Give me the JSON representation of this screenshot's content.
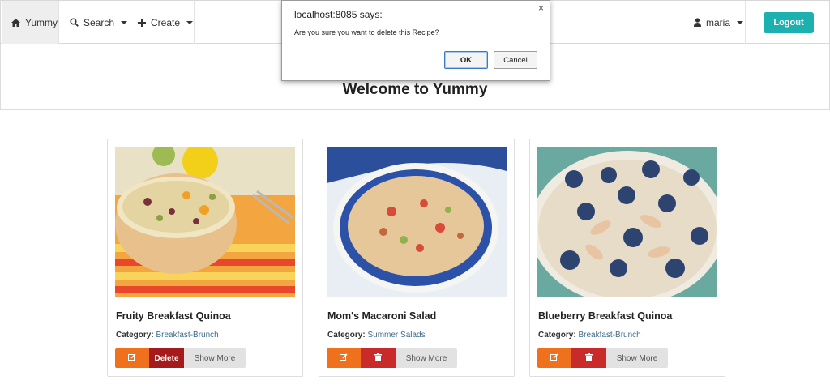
{
  "navbar": {
    "home_label": "Yummy",
    "search_label": "Search",
    "create_label": "Create",
    "user_label": "maria",
    "logout_label": "Logout"
  },
  "header": {
    "title": "Welcome to Yummy"
  },
  "recipes": [
    {
      "name": "Fruity Breakfast Quinoa",
      "category_label": "Category:",
      "category": "Breakfast-Brunch",
      "delete_label": "Delete",
      "show_more_label": "Show More"
    },
    {
      "name": "Mom's Macaroni Salad",
      "category_label": "Category:",
      "category": "Summer Salads",
      "show_more_label": "Show More"
    },
    {
      "name": "Blueberry Breakfast Quinoa",
      "category_label": "Category:",
      "category": "Breakfast-Brunch",
      "show_more_label": "Show More"
    }
  ],
  "dialog": {
    "title": "localhost:8085 says:",
    "message": "Are you sure you want to delete this Recipe?",
    "ok_label": "OK",
    "cancel_label": "Cancel",
    "close_glyph": "×"
  },
  "colors": {
    "accent": "#1cb0b0",
    "edit": "#f0711d",
    "delete": "#c92a2a",
    "show_more": "#e2e2e2"
  }
}
